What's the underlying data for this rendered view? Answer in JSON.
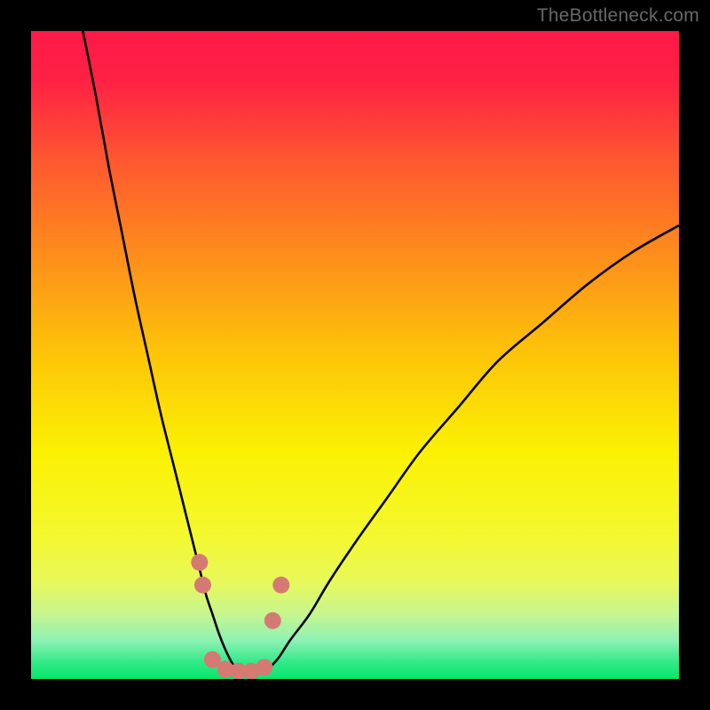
{
  "watermark": "TheBottleneck.com",
  "chart_data": {
    "type": "line",
    "title": "",
    "xlabel": "",
    "ylabel": "",
    "xlim": [
      0,
      100
    ],
    "ylim": [
      0,
      100
    ],
    "grid": false,
    "legend": false,
    "background_gradient": {
      "stops": [
        {
          "pos": 0.0,
          "color": "#ff1948"
        },
        {
          "pos": 0.08,
          "color": "#ff2244"
        },
        {
          "pos": 0.2,
          "color": "#fe5830"
        },
        {
          "pos": 0.35,
          "color": "#fd8f1b"
        },
        {
          "pos": 0.5,
          "color": "#fdc508"
        },
        {
          "pos": 0.65,
          "color": "#fbf103"
        },
        {
          "pos": 0.78,
          "color": "#f3f82f"
        },
        {
          "pos": 0.85,
          "color": "#e8f85a"
        },
        {
          "pos": 0.9,
          "color": "#c7f690"
        },
        {
          "pos": 0.94,
          "color": "#8ef2b4"
        },
        {
          "pos": 0.975,
          "color": "#30e989"
        },
        {
          "pos": 1.0,
          "color": "#06e769"
        }
      ]
    },
    "series": [
      {
        "name": "left-curve",
        "color": "#000000",
        "x": [
          8,
          10,
          12,
          14,
          16,
          18,
          20,
          22,
          24,
          26,
          27,
          28,
          29,
          30,
          31,
          32
        ],
        "y": [
          100,
          90,
          79,
          69,
          59,
          50,
          41,
          33,
          25,
          17,
          13,
          10,
          7,
          4.5,
          2.5,
          1
        ]
      },
      {
        "name": "right-curve",
        "color": "#000000",
        "x": [
          36,
          38,
          40,
          43,
          46,
          50,
          55,
          60,
          66,
          72,
          79,
          86,
          93,
          100
        ],
        "y": [
          1,
          3,
          6,
          10,
          15,
          21,
          28,
          35,
          42,
          49,
          55,
          61,
          66,
          70
        ]
      },
      {
        "name": "trough-markers",
        "type": "scatter",
        "color": "#d57a73",
        "x": [
          26.0,
          26.5,
          28.0,
          30.0,
          32.0,
          34.0,
          36.0,
          37.3,
          38.6
        ],
        "y": [
          18.0,
          14.5,
          3.0,
          1.5,
          1.2,
          1.2,
          1.8,
          9.0,
          14.5
        ]
      }
    ],
    "annotations": []
  }
}
